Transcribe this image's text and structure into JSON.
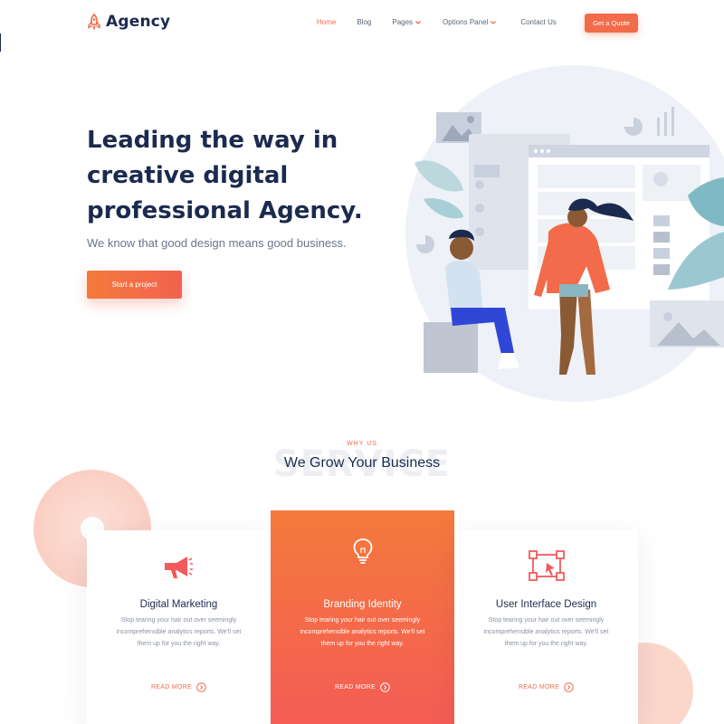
{
  "brand": {
    "name": "Agency"
  },
  "nav": {
    "items": [
      {
        "label": "Home",
        "active": true,
        "dropdown": false
      },
      {
        "label": "Blog",
        "active": false,
        "dropdown": false
      },
      {
        "label": "Pages",
        "active": false,
        "dropdown": true
      },
      {
        "label": "Options Panel",
        "active": false,
        "dropdown": true
      },
      {
        "label": "Contact Us",
        "active": false,
        "dropdown": false
      }
    ],
    "quote_label": "Get a Quote"
  },
  "hero": {
    "title_line1": "Leading the way in",
    "title_line2": "creative digital",
    "title_line3": "professional Agency.",
    "subtitle": "We know that good design means good business.",
    "cta_label": "Start a project"
  },
  "services": {
    "eyebrow": "WHY US",
    "background_word": "SERVICE",
    "title": "We Grow Your Business",
    "cards": [
      {
        "icon": "megaphone-icon",
        "title": "Digital Marketing",
        "text": "Stop tearing your hair out over seemingly incomprehensible analytics reports. We'll set them up for you the right way.",
        "link": "READ MORE"
      },
      {
        "icon": "lightbulb-icon",
        "title": "Branding Identity",
        "text": "Stop tearing your hair out over seemingly incomprehensible analytics reports. We'll set them up for you the right way.",
        "link": "READ MORE"
      },
      {
        "icon": "vector-selection-icon",
        "title": "User Interface Design",
        "text": "Stop tearing your hair out over seemingly incomprehensible analytics reports. We'll set them up for you the right way.",
        "link": "READ MORE"
      }
    ]
  },
  "colors": {
    "accent": "#f26b4a",
    "navy": "#1b2a4e",
    "muted": "#6b7588"
  }
}
